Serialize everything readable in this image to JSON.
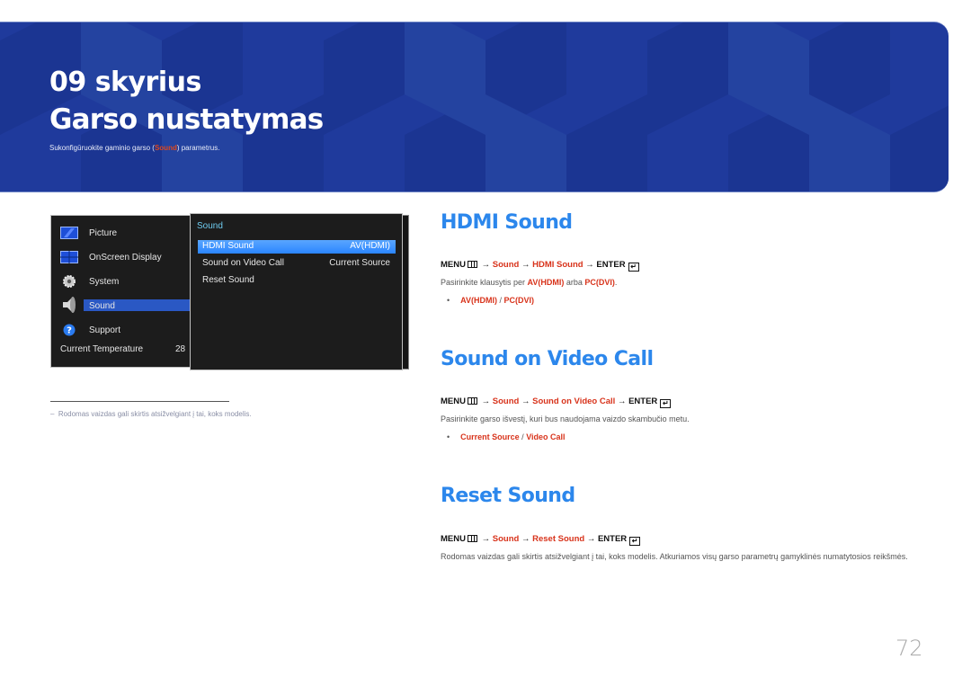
{
  "banner": {
    "chapter": "09 skyrius",
    "title": "Garso nustatymas",
    "subtitle_before": "Sukonfigūruokite gaminio garso (",
    "subtitle_highlight": "Sound",
    "subtitle_after": ") parametrus.",
    "color": "#1f3a9c"
  },
  "osd": {
    "left_menu": [
      {
        "label": "Picture",
        "icon": "picture-icon"
      },
      {
        "label": "OnScreen Display",
        "icon": "onscreen-display-icon"
      },
      {
        "label": "System",
        "icon": "gear-icon"
      },
      {
        "label": "Sound",
        "icon": "speaker-icon",
        "selected": true
      },
      {
        "label": "Support",
        "icon": "question-icon"
      }
    ],
    "temperature_label": "Current Temperature",
    "temperature_value": "28",
    "submenu_title": "Sound",
    "submenu": [
      {
        "label": "HDMI Sound",
        "value": "AV(HDMI)",
        "selected": true
      },
      {
        "label": "Sound on Video Call",
        "value": "Current Source"
      },
      {
        "label": "Reset Sound",
        "value": ""
      }
    ]
  },
  "footnote": "Rodomas vaizdas gali skirtis atsižvelgiant į tai, koks modelis.",
  "footnote_dash": "–",
  "sections": [
    {
      "title": "HDMI Sound",
      "path": {
        "menu": "MENU",
        "arrow": "→",
        "sound": "Sound",
        "item": "HDMI Sound",
        "enter": "ENTER"
      },
      "desc_before": "Pasirinkite klausytis per ",
      "desc_opt1": "AV(HDMI)",
      "desc_mid": " arba ",
      "desc_opt2": "PC(DVI)",
      "desc_after": ".",
      "options": [
        "AV(HDMI)",
        "PC(DVI)"
      ]
    },
    {
      "title": "Sound on Video Call",
      "path": {
        "menu": "MENU",
        "arrow": "→",
        "sound": "Sound",
        "item": "Sound on Video Call",
        "enter": "ENTER"
      },
      "desc": "Pasirinkite garso išvestį, kuri bus naudojama vaizdo skambučio metu.",
      "options": [
        "Current Source",
        "Video Call"
      ]
    },
    {
      "title": "Reset Sound",
      "path": {
        "menu": "MENU",
        "arrow": "→",
        "sound": "Sound",
        "item": "Reset Sound",
        "enter": "ENTER"
      },
      "desc": "Rodomas vaizdas gali skirtis atsižvelgiant į tai, koks modelis. Atkuriamos visų garso parametrų gamyklinės numatytosios reikšmės."
    }
  ],
  "bullet_glyph": "•",
  "option_sep": " / ",
  "enter_glyph": "↵",
  "page_number": "72",
  "colors": {
    "heading": "#2c87ec",
    "accent_red": "#d8331b",
    "osd_select": "#2a85ff"
  }
}
